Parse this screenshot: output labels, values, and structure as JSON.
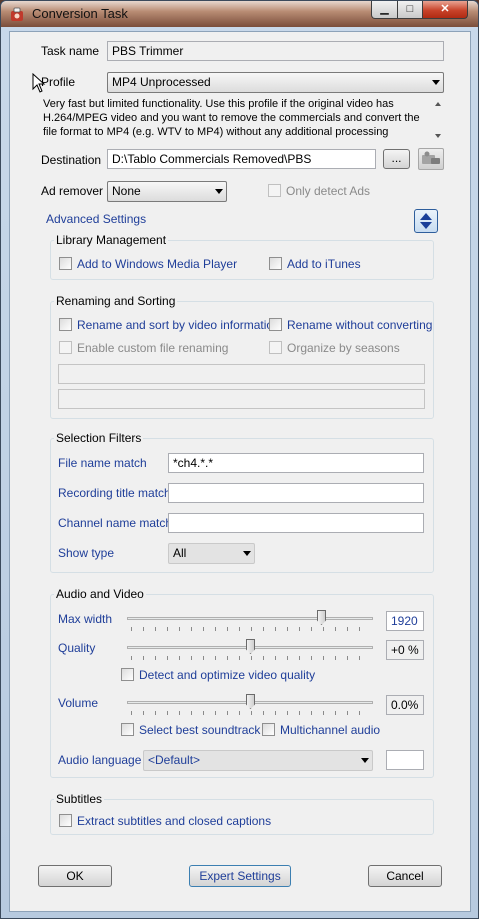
{
  "window": {
    "title": "Conversion Task"
  },
  "task": {
    "name_label": "Task name",
    "name_value": "PBS Trimmer"
  },
  "profile": {
    "label": "Profile",
    "value": "MP4 Unprocessed",
    "description_lines": [
      "Very fast but limited functionality. Use this profile if the original video has",
      "H.264/MPEG video and you want to remove the commercials and convert the",
      "file format to MP4 (e.g. WTV to MP4) without any additional processing"
    ]
  },
  "destination": {
    "label": "Destination",
    "value": "D:\\Tablo Commercials Removed\\PBS",
    "browse_label": "..."
  },
  "ad_remover": {
    "label": "Ad remover",
    "value": "None",
    "only_detect_label": "Only detect Ads"
  },
  "advanced": {
    "label": "Advanced Settings"
  },
  "library": {
    "title": "Library Management",
    "wmp_label": "Add to Windows Media Player",
    "itunes_label": "Add to iTunes"
  },
  "renaming": {
    "title": "Renaming and Sorting",
    "rename_sort_label": "Rename and sort by video information",
    "rename_noconvert_label": "Rename without converting",
    "custom_label": "Enable custom file renaming",
    "seasons_label": "Organize by seasons"
  },
  "filters": {
    "title": "Selection Filters",
    "file_name_label": "File name match",
    "file_name_value": "*ch4.*.*",
    "recording_title_label": "Recording title match",
    "channel_name_label": "Channel name match",
    "show_type_label": "Show type",
    "show_type_value": "All"
  },
  "av": {
    "title": "Audio and Video",
    "max_width_label": "Max width",
    "max_width_value": "1920",
    "max_width_level": 0.8,
    "quality_label": "Quality",
    "quality_value": "+0 %",
    "quality_level": 0.5,
    "detect_optimize_label": "Detect and optimize video quality",
    "volume_label": "Volume",
    "volume_value": "0.0%",
    "volume_level": 0.5,
    "best_soundtrack_label": "Select best soundtrack",
    "multichannel_label": "Multichannel audio",
    "audio_language_label": "Audio language",
    "audio_language_value": "<Default>"
  },
  "subtitles": {
    "title": "Subtitles",
    "extract_label": "Extract subtitles and closed captions"
  },
  "buttons": {
    "ok": "OK",
    "expert": "Expert Settings",
    "cancel": "Cancel"
  },
  "colors": {
    "link_blue": "#1f3e99",
    "titlebar": "#7a4d3a",
    "close_red": "#c8432a"
  }
}
